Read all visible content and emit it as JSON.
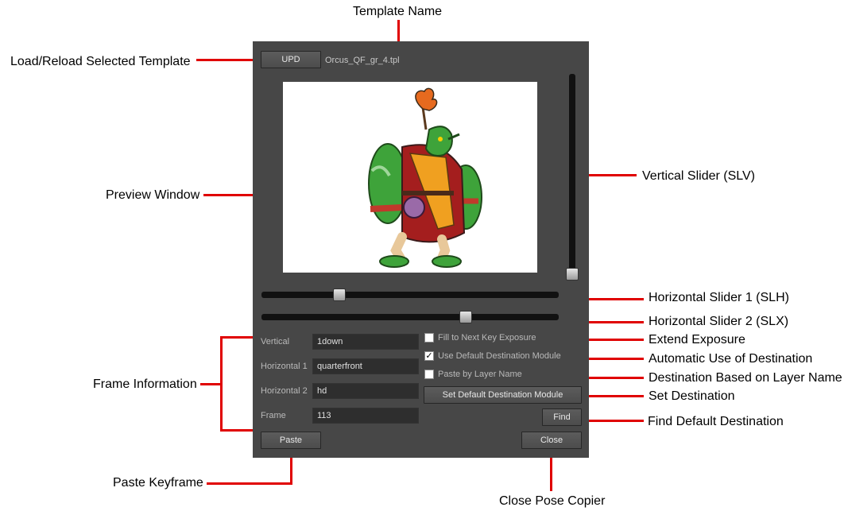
{
  "template": {
    "upd_label": "UPD",
    "name": "Orcus_QF_gr_4.tpl"
  },
  "frame_info": {
    "vertical_label": "Vertical",
    "vertical_value": "1down",
    "horizontal1_label": "Horizontal 1",
    "horizontal1_value": "quarterfront",
    "horizontal2_label": "Horizontal 2",
    "horizontal2_value": "hd",
    "frame_label": "Frame",
    "frame_value": "113"
  },
  "options": {
    "fill_label": "Fill to Next Key Exposure",
    "fill_checked": false,
    "use_default_label": "Use Default Destination Module",
    "use_default_checked": true,
    "paste_by_layer_label": "Paste by Layer Name",
    "paste_by_layer_checked": false
  },
  "buttons": {
    "set_default": "Set Default Destination Module",
    "find": "Find",
    "paste": "Paste",
    "close": "Close"
  },
  "sliders": {
    "vertical_fraction": 0.0,
    "horizontal1_fraction": 0.26,
    "horizontal2_fraction": 0.69
  },
  "callouts": {
    "template_name": "Template Name",
    "load_reload": "Load/Reload Selected Template",
    "preview_window": "Preview Window",
    "vertical_slider": "Vertical Slider (SLV)",
    "horizontal_slider_1": "Horizontal Slider 1 (SLH)",
    "horizontal_slider_2": "Horizontal Slider 2 (SLX)",
    "extend_exposure": "Extend Exposure",
    "automatic_use": "Automatic Use of Destination",
    "frame_information": "Frame Information",
    "destination_layer_name": "Destination Based on Layer Name",
    "set_destination": "Set Destination",
    "find_default": "Find Default Destination",
    "paste_keyframe": "Paste Keyframe",
    "close_pose_copier": "Close Pose Copier"
  },
  "colors": {
    "panel_bg": "#474747",
    "callout_line": "#e00000"
  }
}
